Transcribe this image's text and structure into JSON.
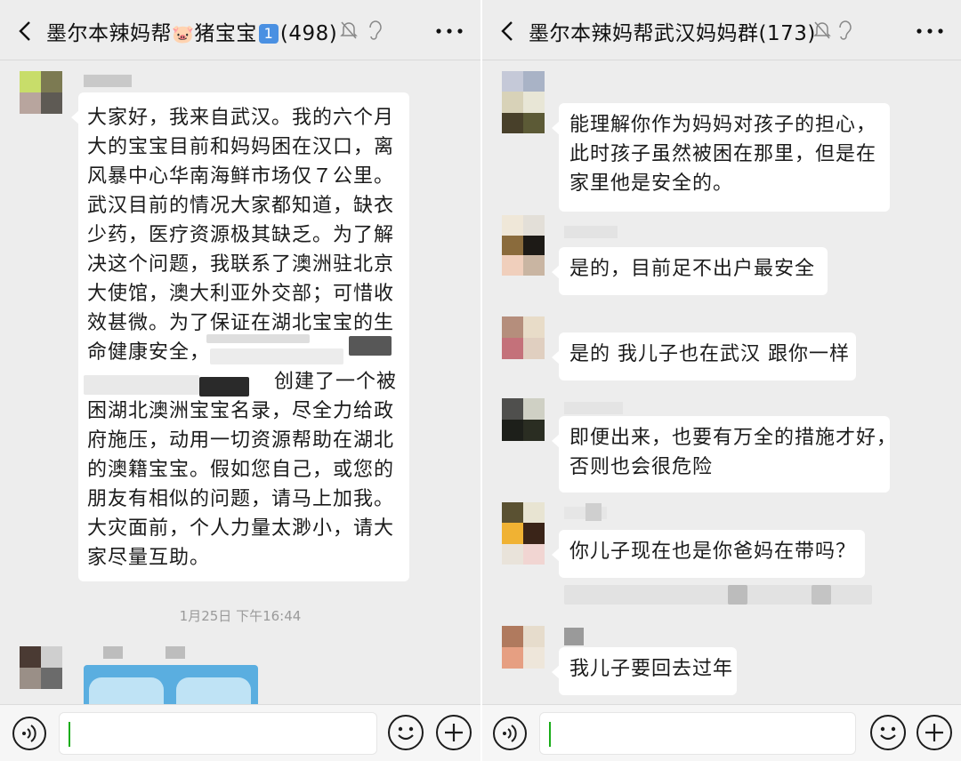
{
  "left_chat": {
    "title": "墨尔本辣妈帮🐷猪宝宝1️⃣(498)",
    "title_parts": {
      "prefix": "墨尔本辣妈帮",
      "pig": "🐷",
      "middle": "猪宝宝",
      "badge": "1",
      "count": "(498)"
    },
    "message_lines": [
      "大家好，我来自武汉。我的六个月",
      "大的宝宝目前和妈妈困在汉口，离",
      "风暴中心华南海鲜市场仅７公里。",
      "武汉目前的情况大家都知道，缺衣",
      "少药，医疗资源极其缺乏。为了解",
      "决这个问题，我联系了澳洲驻北京",
      "大使馆，澳大利亚外交部；可惜收",
      "效甚微。为了保证在湖北宝宝的生",
      "命健康安全，",
      "创建了一个被",
      "困湖北澳洲宝宝名录，尽全力给政",
      "府施压，动用一切资源帮助在湖北",
      "的澳籍宝宝。假如您自己，或您的",
      "朋友有相似的问题，请马上加我。",
      "大灾面前，个人力量太渺小，请大",
      "家尽量互助。"
    ],
    "timestamp": "1月25日 下午16:44"
  },
  "right_chat": {
    "title": "墨尔本辣妈帮武汉妈妈群(173)",
    "messages": [
      {
        "lines": [
          "能理解你作为妈妈对孩子的担心，",
          "此时孩子虽然被困在那里，但是在",
          "家里他是安全的。"
        ]
      },
      {
        "lines": [
          "是的，目前足不出户最安全"
        ]
      },
      {
        "lines": [
          "是的 我儿子也在武汉 跟你一样"
        ]
      },
      {
        "lines": [
          "即便出来，也要有万全的措施才好，",
          "否则也会很危险"
        ]
      },
      {
        "lines": [
          "你儿子现在也是你爸妈在带吗？"
        ]
      },
      {
        "lines": [
          "我儿子要回去过年"
        ]
      }
    ]
  },
  "icons": [
    "back-arrow-icon",
    "mute-bell-icon",
    "ear-icon",
    "more-icon",
    "voice-icon",
    "emoji-icon",
    "plus-icon"
  ],
  "colors": {
    "background": "#ededed",
    "bubble": "#ffffff",
    "caret": "#1aad19",
    "badge": "#4a90e2",
    "text": "#1b1b1b"
  }
}
